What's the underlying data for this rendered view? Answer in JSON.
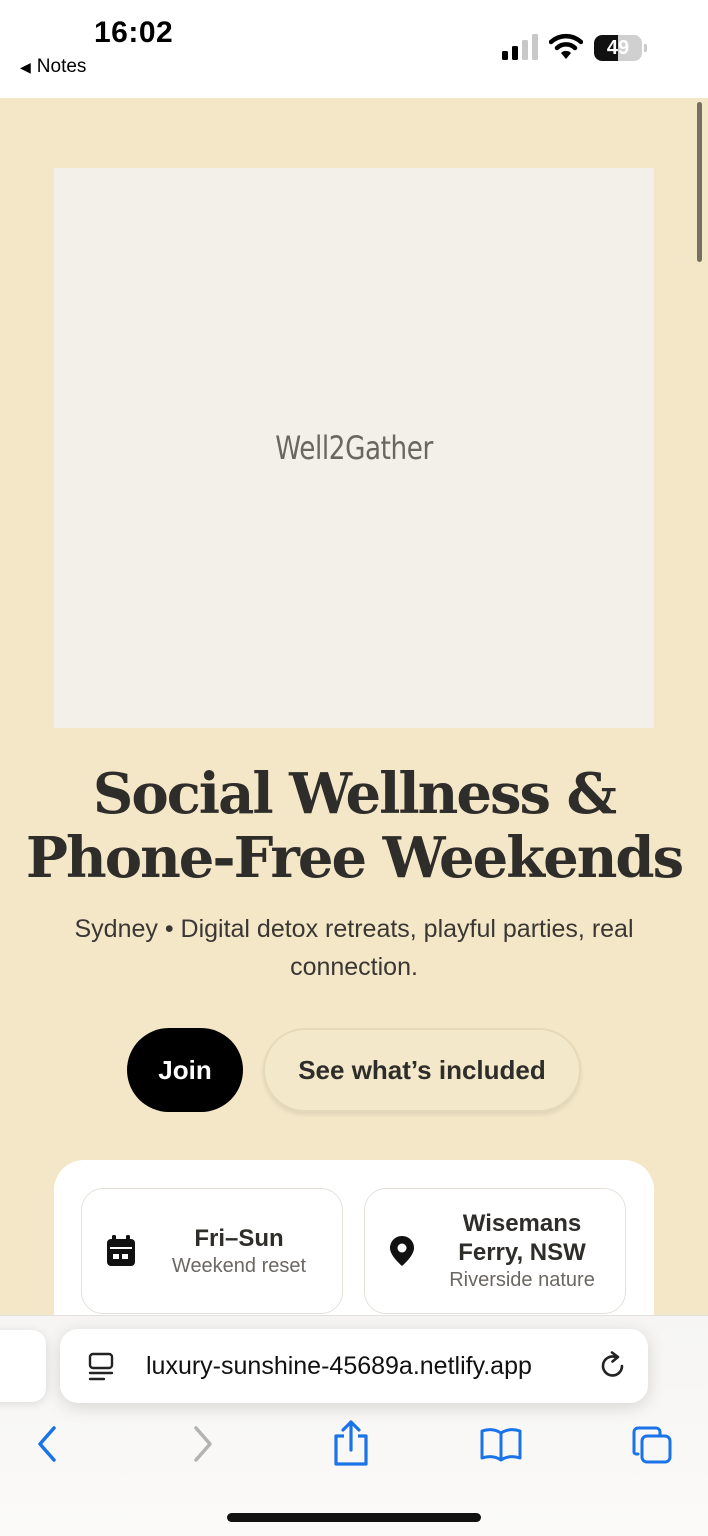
{
  "status_bar": {
    "time": "16:02",
    "back_label": "Notes",
    "back_icon": "back-triangle-icon",
    "battery_level": "49",
    "icons": [
      "cellular-signal-icon",
      "wifi-icon",
      "battery-icon"
    ]
  },
  "hero": {
    "image_text": "Well2Gather",
    "headline_line1": "Social Wellness &",
    "headline_line2": "Phone-Free Weekends",
    "subtitle": "Sydney • Digital detox retreats, playful parties, real connection.",
    "primary_button": "Join",
    "secondary_button": "See what’s included"
  },
  "info": {
    "when": {
      "icon": "calendar-icon",
      "title": "Fri–Sun",
      "subtitle": "Weekend reset"
    },
    "where": {
      "icon": "location-pin-icon",
      "title": "Wisemans Ferry, NSW",
      "subtitle": "Riverside nature"
    }
  },
  "browser": {
    "url": "luxury-sunshine-45689a.netlify.app",
    "toolbar_icons": [
      "back-arrow-icon",
      "forward-arrow-icon",
      "share-icon",
      "bookmarks-icon",
      "tabs-icon"
    ]
  },
  "colors": {
    "page_background": "#f4e7c8",
    "primary_button": "#000000",
    "text_dark": "#2f2d2a",
    "safari_accent": "#1a73e8"
  }
}
